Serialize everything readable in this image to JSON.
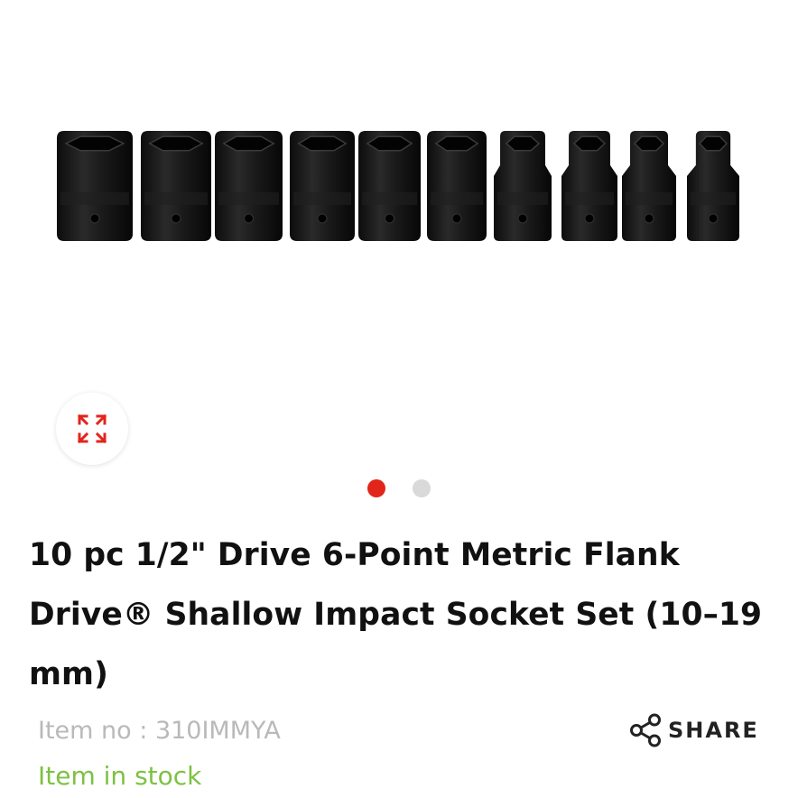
{
  "product": {
    "title": "10 pc 1/2\" Drive 6-Point Metric Flank Drive® Shallow Impact Socket Set (10–19 mm)",
    "item_no": "Item no : 310IMMYA",
    "stock_status": "Item in stock",
    "share_label": "SHARE"
  },
  "gallery": {
    "image_icon": "socket-set-image",
    "zoom_icon": "expand-arrows-icon",
    "slide_count": 2,
    "active_slide": 1
  },
  "colors": {
    "accent": "#e2251b",
    "stock": "#7cc242",
    "muted": "#b9b9b9",
    "dot_inactive": "#d9d9d9"
  }
}
